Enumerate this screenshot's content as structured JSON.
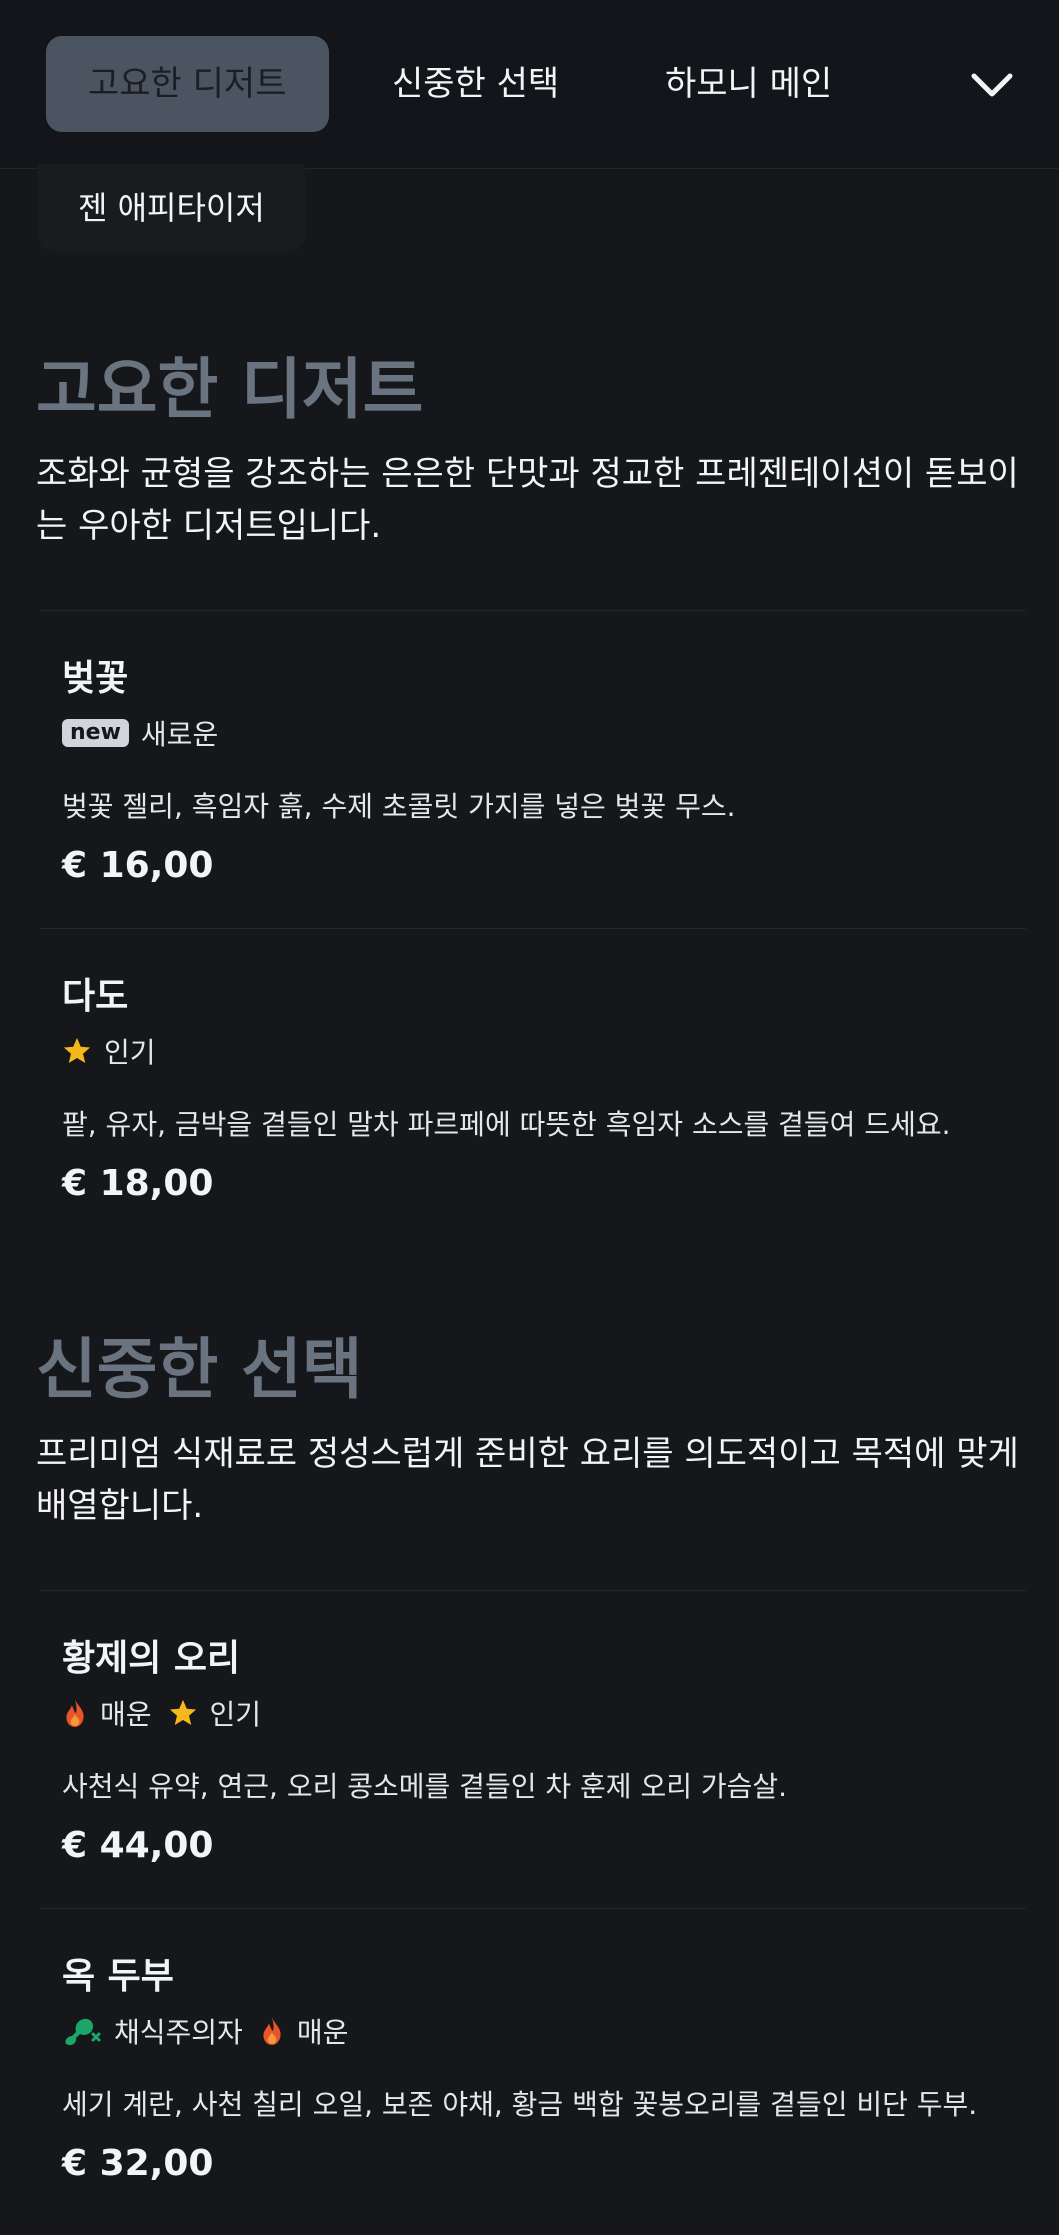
{
  "nav": {
    "tabs": [
      {
        "label": "고요한 디저트",
        "active": true
      },
      {
        "label": "신중한 선택"
      },
      {
        "label": "하모니 메인"
      }
    ],
    "overflow_tab": {
      "label": "젠 애피타이저"
    }
  },
  "sections": [
    {
      "title": "고요한 디저트",
      "description": "조화와 균형을 강조하는 은은한 단맛과 정교한 프레젠테이션이 돋보이는 우아한 디저트입니다.",
      "items": [
        {
          "name": "벚꽃",
          "tags": [
            {
              "icon": "new-badge",
              "badge": "new",
              "label": "새로운"
            }
          ],
          "description": "벚꽃 젤리, 흑임자 흙, 수제 초콜릿 가지를 넣은 벚꽃 무스.",
          "price": "€ 16,00"
        },
        {
          "name": "다도",
          "tags": [
            {
              "icon": "star-icon",
              "label": "인기"
            }
          ],
          "description": "팥, 유자, 금박을 곁들인 말차 파르페에 따뜻한 흑임자 소스를 곁들여 드세요.",
          "price": "€ 18,00"
        }
      ]
    },
    {
      "title": "신중한 선택",
      "description": "프리미엄 식재료로 정성스럽게 준비한 요리를 의도적이고 목적에 맞게 배열합니다.",
      "items": [
        {
          "name": "황제의 오리",
          "tags": [
            {
              "icon": "flame-icon",
              "label": "매운"
            },
            {
              "icon": "star-icon",
              "label": "인기"
            }
          ],
          "description": "사천식 유약, 연근, 오리 콩소메를 곁들인 차 훈제 오리 가슴살.",
          "price": "€ 44,00"
        },
        {
          "name": "옥 두부",
          "tags": [
            {
              "icon": "no-meat-icon",
              "label": "채식주의자"
            },
            {
              "icon": "flame-icon",
              "label": "매운"
            }
          ],
          "description": "세기 계란, 사천 칠리 오일, 보존 야채, 황금 백합 꽃봉오리를 곁들인 비단 두부.",
          "price": "€ 32,00"
        }
      ]
    }
  ],
  "colors": {
    "background": "#16171b",
    "heading": "#6a7480",
    "active_tab": "#4a5561",
    "star": "#f5b81c",
    "flame": "#e8552b",
    "vegetarian": "#1aa66b"
  }
}
